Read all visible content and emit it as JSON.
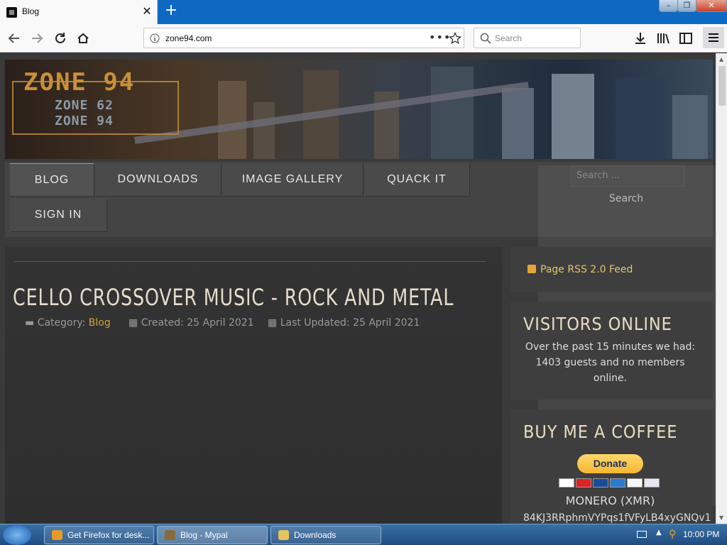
{
  "browser": {
    "tab_title": "Blog",
    "url": "zone94.com",
    "search_placeholder": "Search"
  },
  "site": {
    "logo_main": "ZONE 94",
    "logo_sub1": "ZONE 62",
    "logo_sub2": "ZONE 94",
    "menu": [
      "BLOG",
      "DOWNLOADS",
      "IMAGE GALLERY",
      "QUACK IT",
      "SIGN IN"
    ],
    "search_placeholder": "Search ...",
    "search_button": "Search"
  },
  "article": {
    "title": "CELLO CROSSOVER MUSIC - ROCK AND METAL",
    "category_label": "Category:",
    "category_value": "Blog",
    "created": "Created: 25 April 2021",
    "updated": "Last Updated: 25 April 2021"
  },
  "sidebar": {
    "rss": "Page RSS 2.0 Feed",
    "visitors_heading": "VISITORS ONLINE",
    "visitors_text": "Over the past 15 minutes we had: 1403 guests and no members online.",
    "coffee_heading": "BUY ME A COFFEE",
    "donate_label": "Donate",
    "monero_label": "MONERO (XMR)",
    "monero_address": "84KJ3RRphmVYPqs1fVFyLB4xyGNQv1"
  },
  "taskbar": {
    "tasks": [
      "Get Firefox for desk...",
      "Blog - Mypal",
      "Downloads"
    ],
    "time": "10:00 PM"
  }
}
